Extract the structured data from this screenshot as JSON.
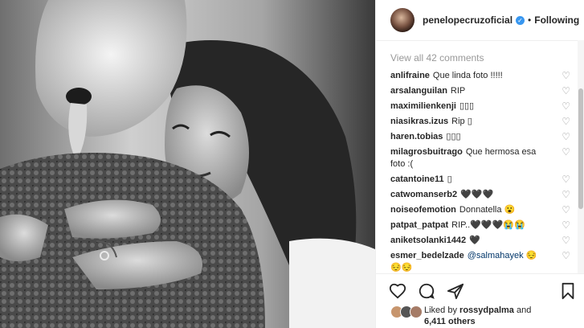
{
  "header": {
    "username": "penelopecruzoficial",
    "separator": "•",
    "follow_status": "Following"
  },
  "comments": {
    "view_all": "View all 42 comments",
    "items": [
      {
        "user": "anlifraine",
        "text": "Que linda foto !!!!!"
      },
      {
        "user": "arsalanguilan",
        "text": "RIP"
      },
      {
        "user": "maximilienkenji",
        "text": "▯▯▯"
      },
      {
        "user": "niasikras.izus",
        "text": "Rip ▯"
      },
      {
        "user": "haren.tobias",
        "text": "▯▯▯"
      },
      {
        "user": "milagrosbuitrago",
        "text": "Que hermosa esa foto :("
      },
      {
        "user": "catantoine11",
        "text": "▯"
      },
      {
        "user": "catwomanserb2",
        "text": "🖤🖤🖤"
      },
      {
        "user": "noiseofemotion",
        "text": "Donnatella 😮"
      },
      {
        "user": "patpat_patpat",
        "text": "RIP..🖤🖤🖤😭😭"
      },
      {
        "user": "aniketsolanki1442",
        "text": "🖤"
      },
      {
        "user": "esmer_bedelzade",
        "text": "😔😔😔",
        "mention": "@salmahayek"
      }
    ]
  },
  "likes": {
    "prefix": "Liked by",
    "user": "rossydpalma",
    "middle": "and",
    "others": "6,411 others"
  },
  "icons": [
    "heart-icon",
    "comment-icon",
    "share-icon",
    "bookmark-icon",
    "verified-icon"
  ]
}
